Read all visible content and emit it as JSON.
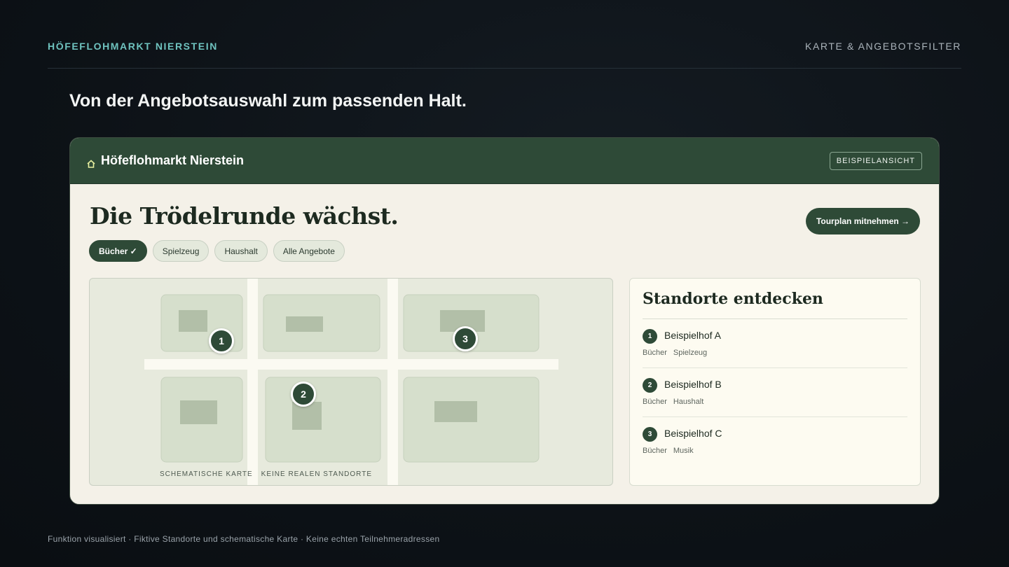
{
  "header": {
    "brand": "HÖFEFLOHMARKT NIERSTEIN",
    "section": "KARTE & ANGEBOTSFILTER"
  },
  "headline": "Von der Angebotsauswahl zum passenden Halt.",
  "app": {
    "title": "Höfeflohmarkt Nierstein",
    "badge": "BEISPIELANSICHT",
    "heading": "Die Trödelrunde wächst.",
    "cta_label": "Tourplan mitnehmen →",
    "filters": [
      {
        "label": "Bücher ✓",
        "active": true
      },
      {
        "label": "Spielzeug",
        "active": false
      },
      {
        "label": "Haushalt",
        "active": false
      },
      {
        "label": "Alle Angebote",
        "active": false
      }
    ],
    "map": {
      "caption_1": "SCHEMATISCHE KARTE",
      "caption_2": "KEINE REALEN STANDORTE",
      "markers": [
        "1",
        "2",
        "3"
      ]
    },
    "panel": {
      "title": "Standorte entdecken",
      "locations": [
        {
          "num": "1",
          "name": "Beispielhof A",
          "tags": [
            "Bücher",
            "Spielzeug"
          ]
        },
        {
          "num": "2",
          "name": "Beispielhof B",
          "tags": [
            "Bücher",
            "Haushalt"
          ]
        },
        {
          "num": "3",
          "name": "Beispielhof C",
          "tags": [
            "Bücher",
            "Musik"
          ]
        }
      ]
    }
  },
  "footer": "Funktion visualisiert · Fiktive Standorte und schematische Karte · Keine echten Teilnehmeradressen",
  "colors": {
    "accent_green": "#2e4a37",
    "brand_teal": "#6fc3bf",
    "page_bg": "#0d1217",
    "card_bg": "#f4f1e8"
  }
}
